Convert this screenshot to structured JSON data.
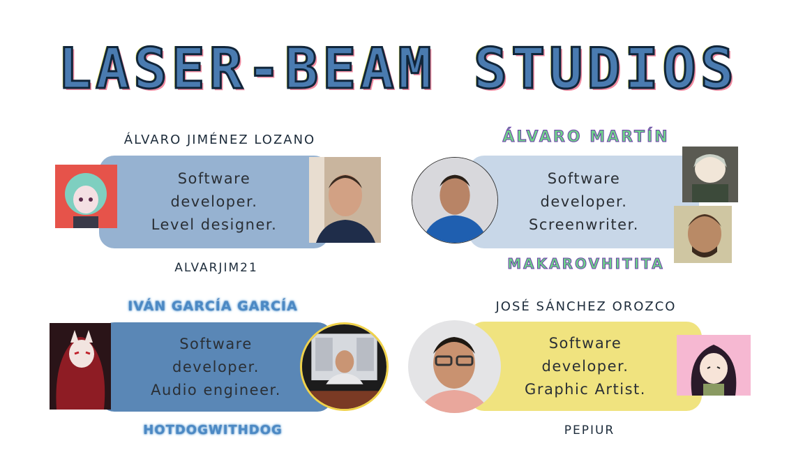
{
  "title": "LASER-BEAM STUDIOS",
  "colors": {
    "card_blue_grey": "#96b2d1",
    "card_pale_blue": "#c8d7e8",
    "card_steel_blue": "#5a87b6",
    "card_yellow": "#f0e37f"
  },
  "members": [
    {
      "name": "ÁLVARO JIMÉNEZ LOZANO",
      "roles": [
        "Software",
        "developer.",
        "Level designer."
      ],
      "handle": "ALVARJIM21",
      "avatar_icon": "anime-avatar-icon",
      "photo_icon": "portrait-photo-icon"
    },
    {
      "name": "ÁLVARO MARTÍN",
      "roles": [
        "Software",
        "developer.",
        "Screenwriter."
      ],
      "handle": "MAKAROVHITITA",
      "avatar_icon": "soldier-avatar-icon",
      "photo_icon": "portrait-photo-icon"
    },
    {
      "name": "IVÁN GARCÍA GARCÍA",
      "roles": [
        "Software",
        "developer.",
        "Audio engineer."
      ],
      "handle": "HOTDOGWITHDOG",
      "avatar_icon": "fox-mask-avatar-icon",
      "photo_icon": "portrait-photo-icon"
    },
    {
      "name": "JOSÉ SÁNCHEZ OROZCO",
      "roles": [
        "Software",
        "developer.",
        "Graphic Artist."
      ],
      "handle": "PEPIUR",
      "avatar_icon": "anime-girl-avatar-icon",
      "photo_icon": "portrait-photo-icon"
    }
  ]
}
